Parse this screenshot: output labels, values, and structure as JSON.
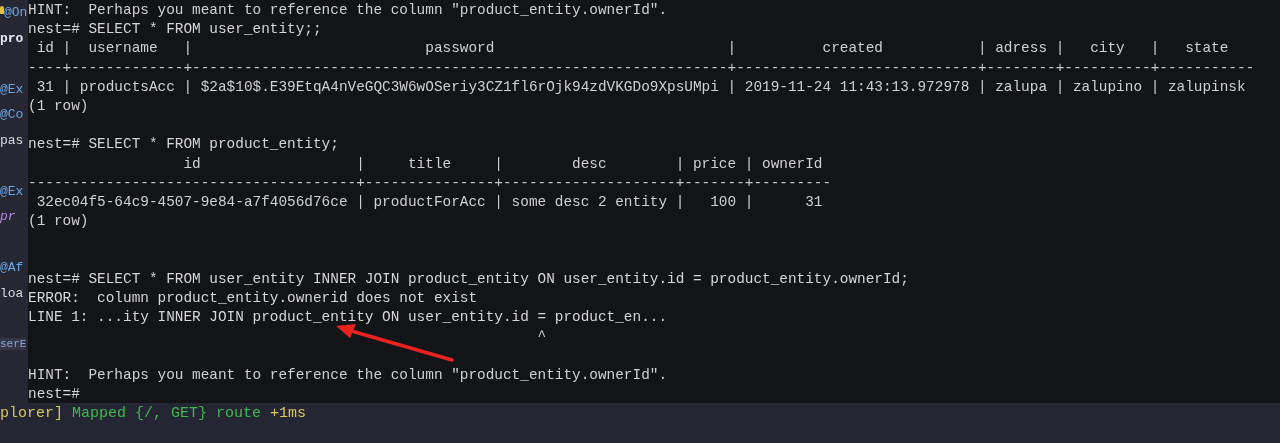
{
  "editor_gutter": [
    {
      "kind": "decorator",
      "text": "@On",
      "bulb": true
    },
    {
      "kind": "keyword",
      "text": "pro"
    },
    {
      "kind": "blank"
    },
    {
      "kind": "decorator",
      "text": "@Ex"
    },
    {
      "kind": "decorator",
      "text": "@Co"
    },
    {
      "kind": "field",
      "text": "pas"
    },
    {
      "kind": "blank"
    },
    {
      "kind": "decorator",
      "text": "@Ex"
    },
    {
      "kind": "modifier",
      "text": "pr"
    },
    {
      "kind": "blank"
    },
    {
      "kind": "decorator",
      "text": "@Af"
    },
    {
      "kind": "field",
      "text": "loa"
    },
    {
      "kind": "blank"
    },
    {
      "kind": "tab",
      "text": "serE"
    }
  ],
  "terminal": {
    "lines": [
      {
        "kind": "hint",
        "text": "HINT:  Perhaps you meant to reference the column \"product_entity.ownerId\"."
      },
      {
        "kind": "prompt",
        "text": "nest=# SELECT * FROM user_entity;;"
      },
      {
        "kind": "table_header",
        "text": " id |  username   |                           password                           |          created           | adress |   city   |   state"
      },
      {
        "kind": "table_divider",
        "text": "----+-------------+--------------------------------------------------------------+----------------------------+--------+----------+-----------"
      },
      {
        "kind": "table_row",
        "text": " 31 | productsAcc | $2a$10$.E39EtqA4nVeGQC3W6wOSeriy3CZ1fl6rOjk94zdVKGDo9XpsUMpi | 2019-11-24 11:43:13.972978 | zalupa | zalupino | zalupinsk"
      },
      {
        "kind": "footer",
        "text": "(1 row)"
      },
      {
        "kind": "blank"
      },
      {
        "kind": "prompt",
        "text": "nest=# SELECT * FROM product_entity;"
      },
      {
        "kind": "table_header",
        "text": "                  id                  |     title     |        desc        | price | ownerId"
      },
      {
        "kind": "table_divider",
        "text": "--------------------------------------+---------------+--------------------+-------+---------"
      },
      {
        "kind": "table_row",
        "text": " 32ec04f5-64c9-4507-9e84-a7f4056d76ce | productForAcc | some desc 2 entity |   100 |      31"
      },
      {
        "kind": "footer",
        "text": "(1 row)"
      },
      {
        "kind": "blank"
      },
      {
        "kind": "blank"
      },
      {
        "kind": "prompt",
        "text": "nest=# SELECT * FROM user_entity INNER JOIN product_entity ON user_entity.id = product_entity.ownerId;"
      },
      {
        "kind": "error",
        "text": "ERROR:  column product_entity.ownerid does not exist"
      },
      {
        "kind": "error",
        "text": "LINE 1: ...ity INNER JOIN product_entity ON user_entity.id = product_en..."
      },
      {
        "kind": "caret",
        "text": "                                                           ^"
      },
      {
        "kind": "blank"
      },
      {
        "kind": "hint",
        "text": "HINT:  Perhaps you meant to reference the column \"product_entity.ownerId\"."
      },
      {
        "kind": "prompt",
        "text": "nest=#"
      }
    ]
  },
  "log": {
    "segments": [
      {
        "kind": "source",
        "text": "plorer]"
      },
      {
        "kind": "message",
        "text": "Mapped {/, GET} route"
      },
      {
        "kind": "timing",
        "text": "+1ms"
      }
    ]
  }
}
